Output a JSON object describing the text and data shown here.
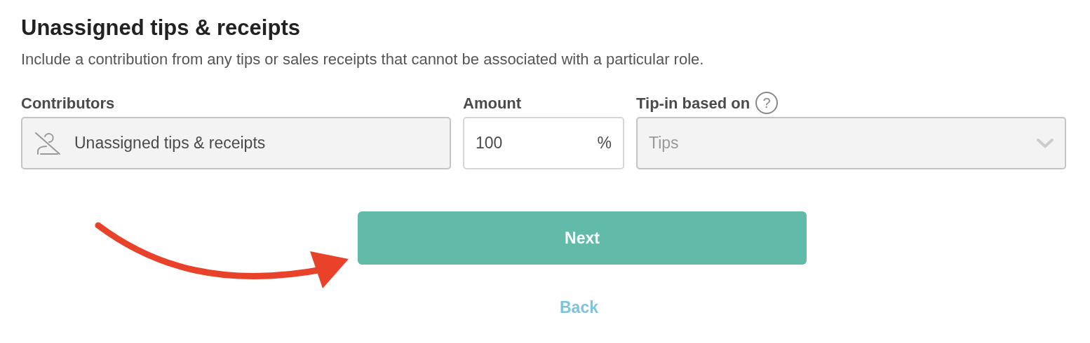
{
  "section": {
    "title": "Unassigned tips & receipts",
    "description": "Include a contribution from any tips or sales receipts that cannot be associated with a particular role."
  },
  "contributors": {
    "label": "Contributors",
    "value": "Unassigned tips & receipts",
    "disabled": true
  },
  "amount": {
    "label": "Amount",
    "value": "100",
    "unit": "%",
    "disabled": false
  },
  "tip_in": {
    "label": "Tip-in based on",
    "help": "?",
    "value": "Tips",
    "disabled": true
  },
  "buttons": {
    "next": "Next",
    "back": "Back"
  }
}
